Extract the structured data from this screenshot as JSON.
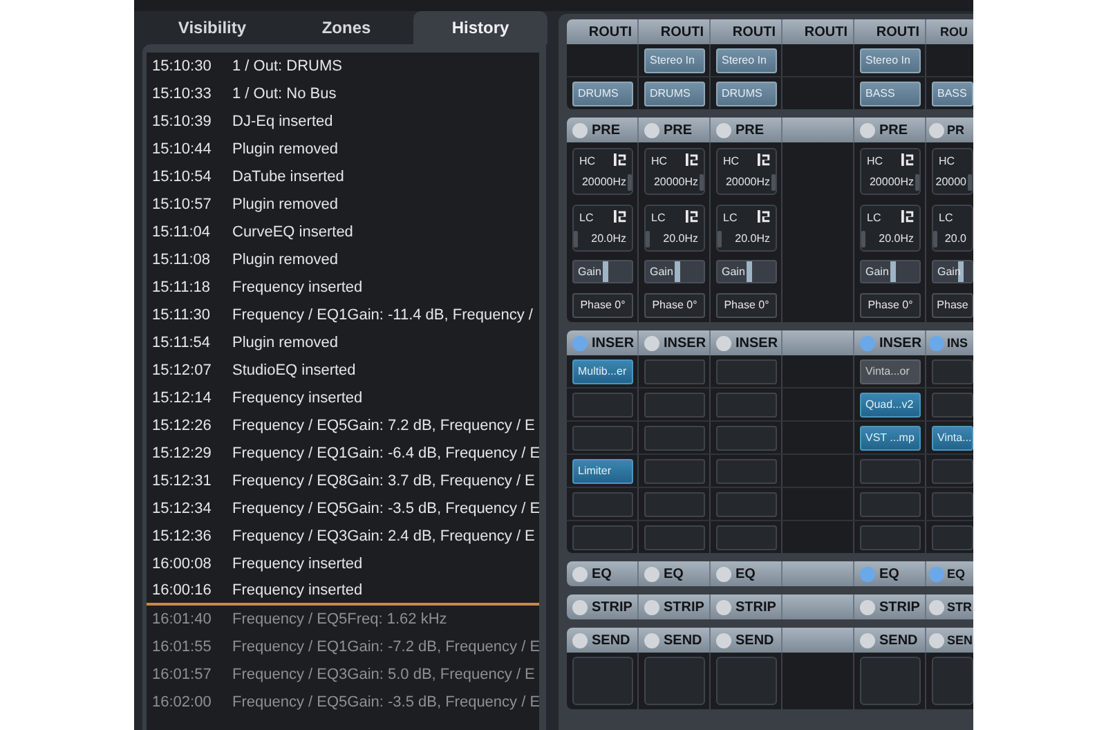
{
  "tabs": [
    {
      "label": "Visibility",
      "selected": false
    },
    {
      "label": "Zones",
      "selected": false
    },
    {
      "label": "History",
      "selected": true
    }
  ],
  "history": [
    {
      "time": "15:10:30",
      "action": "1 / Out: DRUMS",
      "undone": false
    },
    {
      "time": "15:10:33",
      "action": "1 / Out: No Bus",
      "undone": false
    },
    {
      "time": "15:10:39",
      "action": "DJ-Eq inserted",
      "undone": false
    },
    {
      "time": "15:10:44",
      "action": "Plugin removed",
      "undone": false
    },
    {
      "time": "15:10:54",
      "action": "DaTube inserted",
      "undone": false
    },
    {
      "time": "15:10:57",
      "action": "Plugin removed",
      "undone": false
    },
    {
      "time": "15:11:04",
      "action": "CurveEQ inserted",
      "undone": false
    },
    {
      "time": "15:11:08",
      "action": "Plugin removed",
      "undone": false
    },
    {
      "time": "15:11:18",
      "action": "Frequency inserted",
      "undone": false
    },
    {
      "time": "15:11:30",
      "action": "Frequency / EQ1Gain: -11.4 dB, Frequency /",
      "undone": false
    },
    {
      "time": "15:11:54",
      "action": "Plugin removed",
      "undone": false
    },
    {
      "time": "15:12:07",
      "action": "StudioEQ inserted",
      "undone": false
    },
    {
      "time": "15:12:14",
      "action": "Frequency inserted",
      "undone": false
    },
    {
      "time": "15:12:26",
      "action": "Frequency / EQ5Gain: 7.2 dB, Frequency / E",
      "undone": false
    },
    {
      "time": "15:12:29",
      "action": "Frequency / EQ1Gain: -6.4 dB, Frequency / E",
      "undone": false
    },
    {
      "time": "15:12:31",
      "action": "Frequency / EQ8Gain: 3.7 dB, Frequency / E",
      "undone": false
    },
    {
      "time": "15:12:34",
      "action": "Frequency / EQ5Gain: -3.5 dB, Frequency / E",
      "undone": false
    },
    {
      "time": "15:12:36",
      "action": "Frequency / EQ3Gain: 2.4 dB, Frequency / E",
      "undone": false
    },
    {
      "time": "16:00:08",
      "action": "Frequency inserted",
      "undone": false
    },
    {
      "time": "16:00:16",
      "action": "Frequency inserted",
      "undone": false
    },
    {
      "time": "16:01:40",
      "action": "Frequency / EQ5Freq: 1.62 kHz",
      "undone": true
    },
    {
      "time": "16:01:55",
      "action": "Frequency / EQ1Gain: -7.2 dB, Frequency / E",
      "undone": true
    },
    {
      "time": "16:01:57",
      "action": "Frequency / EQ3Gain: 5.0 dB, Frequency / E",
      "undone": true
    },
    {
      "time": "16:02:00",
      "action": "Frequency / EQ5Gain: -3.5 dB, Frequency / E",
      "undone": true
    }
  ],
  "mixer": {
    "columns": [
      {
        "routing": {
          "label": "ROUTI",
          "output": "DRUMS"
        },
        "pre": {
          "on": false,
          "label": "PRE",
          "hc": {
            "label": "HC",
            "value": "20000Hz"
          },
          "lc": {
            "label": "LC",
            "value": "20.0Hz"
          },
          "gain": {
            "label": "Gain",
            "level": 0.6
          },
          "phase": "Phase 0°"
        },
        "insert": {
          "on": true,
          "label": "INSER",
          "slots": [
            {
              "kind": "plugin",
              "name": "Multib...er",
              "active": true
            },
            {
              "kind": "empty"
            },
            {
              "kind": "empty"
            },
            {
              "kind": "plugin",
              "name": "Limiter",
              "active": true
            },
            {
              "kind": "empty"
            },
            {
              "kind": "empty"
            }
          ]
        },
        "eq": {
          "on": false,
          "label": "EQ"
        },
        "strip": {
          "on": false,
          "label": "STRIP"
        },
        "sends": {
          "on": false,
          "label": "SEND"
        }
      },
      {
        "routing": {
          "label": "ROUTI",
          "input": "Stereo In",
          "output": "DRUMS"
        },
        "pre": {
          "on": false,
          "label": "PRE",
          "hc": {
            "label": "HC",
            "value": "20000Hz"
          },
          "lc": {
            "label": "LC",
            "value": "20.0Hz"
          },
          "gain": {
            "label": "Gain",
            "level": 0.6
          },
          "phase": "Phase 0°"
        },
        "insert": {
          "on": false,
          "label": "INSER",
          "slots": [
            {
              "kind": "empty"
            },
            {
              "kind": "empty"
            },
            {
              "kind": "empty"
            },
            {
              "kind": "empty"
            },
            {
              "kind": "empty"
            },
            {
              "kind": "empty"
            }
          ]
        },
        "eq": {
          "on": false,
          "label": "EQ"
        },
        "strip": {
          "on": false,
          "label": "STRIP"
        },
        "sends": {
          "on": false,
          "label": "SEND"
        }
      },
      {
        "routing": {
          "label": "ROUTI",
          "input": "Stereo In",
          "output": "DRUMS"
        },
        "pre": {
          "on": false,
          "label": "PRE",
          "hc": {
            "label": "HC",
            "value": "20000Hz"
          },
          "lc": {
            "label": "LC",
            "value": "20.0Hz"
          },
          "gain": {
            "label": "Gain",
            "level": 0.6
          },
          "phase": "Phase 0°"
        },
        "insert": {
          "on": false,
          "label": "INSER",
          "slots": [
            {
              "kind": "empty"
            },
            {
              "kind": "empty"
            },
            {
              "kind": "empty"
            },
            {
              "kind": "empty"
            },
            {
              "kind": "empty"
            },
            {
              "kind": "empty"
            }
          ]
        },
        "eq": {
          "on": false,
          "label": "EQ"
        },
        "strip": {
          "on": false,
          "label": "STRIP"
        },
        "sends": {
          "on": false,
          "label": "SEND"
        }
      },
      {
        "routing": {
          "label": "ROUTI"
        }
      },
      {
        "routing": {
          "label": "ROUTI",
          "input": "Stereo In",
          "output": "BASS"
        },
        "pre": {
          "on": false,
          "label": "PRE",
          "hc": {
            "label": "HC",
            "value": "20000Hz"
          },
          "lc": {
            "label": "LC",
            "value": "20.0Hz"
          },
          "gain": {
            "label": "Gain",
            "level": 0.6
          },
          "phase": "Phase 0°"
        },
        "insert": {
          "on": true,
          "label": "INSER",
          "slots": [
            {
              "kind": "plugin",
              "name": "Vinta...or",
              "active": false
            },
            {
              "kind": "plugin",
              "name": "Quad...v2",
              "active": true
            },
            {
              "kind": "plugin",
              "name": "VST ...mp",
              "active": true
            },
            {
              "kind": "empty"
            },
            {
              "kind": "empty"
            },
            {
              "kind": "empty"
            }
          ]
        },
        "eq": {
          "on": true,
          "label": "EQ"
        },
        "strip": {
          "on": false,
          "label": "STRIP"
        },
        "sends": {
          "on": false,
          "label": "SEND"
        }
      },
      {
        "routing": {
          "label": "ROU",
          "output": "BASS"
        },
        "pre": {
          "on": false,
          "label": "PR",
          "hc": {
            "label": "HC",
            "value": "20000"
          },
          "lc": {
            "label": "LC",
            "value": "20.0"
          },
          "gain": {
            "label": "Gain",
            "level": 0.8
          },
          "phase": "Phase"
        },
        "insert": {
          "on": true,
          "label": "INS",
          "slots": [
            {
              "kind": "empty"
            },
            {
              "kind": "empty"
            },
            {
              "kind": "plugin",
              "name": "Vinta...",
              "active": true
            },
            {
              "kind": "empty"
            },
            {
              "kind": "empty"
            },
            {
              "kind": "empty"
            }
          ]
        },
        "eq": {
          "on": true,
          "label": "EQ"
        },
        "strip": {
          "on": false,
          "label": "STR"
        },
        "sends": {
          "on": false,
          "label": "SEN"
        }
      }
    ]
  }
}
